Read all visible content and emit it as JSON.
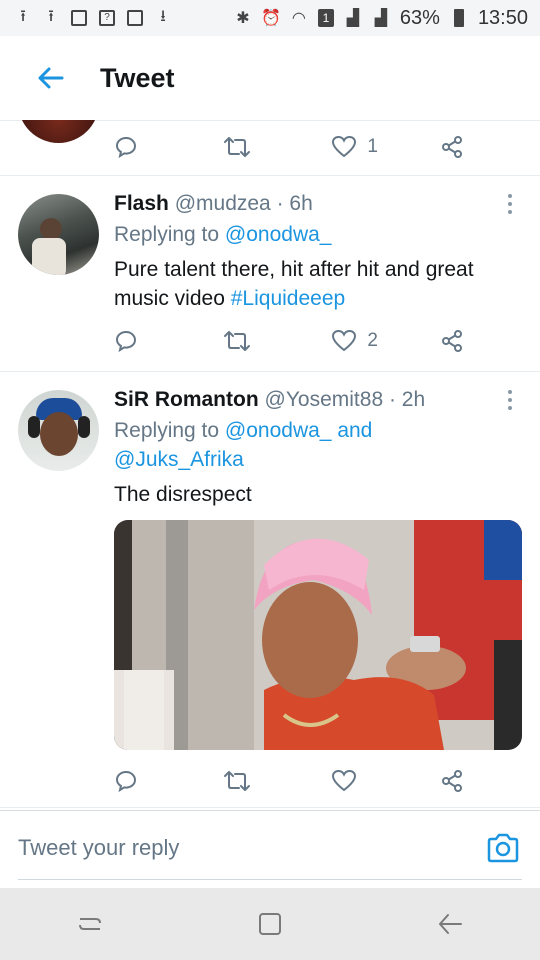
{
  "status_bar": {
    "battery": "63%",
    "time": "13:50",
    "sim_label": "1"
  },
  "header": {
    "title": "Tweet"
  },
  "tweets": [
    {
      "like_count": "1"
    },
    {
      "name": "Flash",
      "handle": "@mudzea",
      "time": "· 6h",
      "replying_label": "Replying to",
      "replying_to": "@onodwa_",
      "text": "Pure talent there, hit after hit and great",
      "text_line2": "music video",
      "hashtag": "#Liquideeep",
      "like_count": "2"
    },
    {
      "name": "SiR Romanton",
      "handle": "@Yosemit88",
      "time": "· 2h",
      "replying_label": "Replying to",
      "replying_to": "@onodwa_",
      "and_text": "and",
      "replying_to_2": "@Juks_Afrika",
      "text": "The disrespect",
      "like_count": ""
    }
  ],
  "reply": {
    "placeholder": "Tweet your reply"
  },
  "colors": {
    "accent": "#1b95e0",
    "muted": "#657786",
    "divider": "#e6ecf0"
  }
}
